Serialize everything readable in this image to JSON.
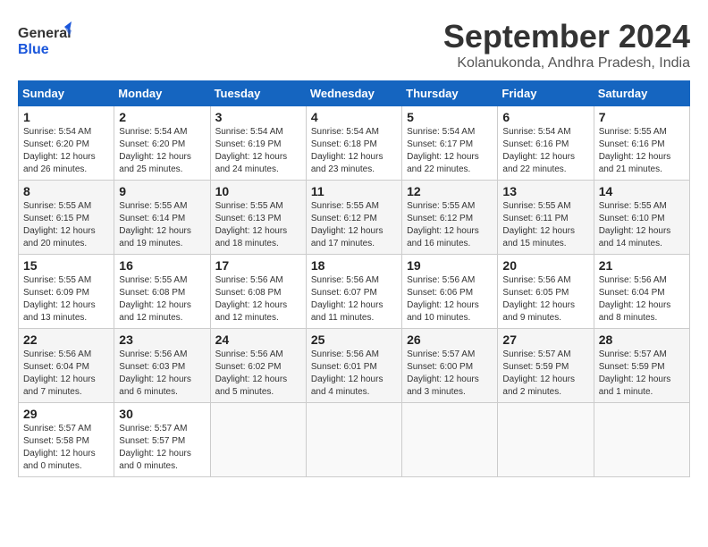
{
  "header": {
    "logo_general": "General",
    "logo_blue": "Blue",
    "month": "September 2024",
    "location": "Kolanukonda, Andhra Pradesh, India"
  },
  "days_of_week": [
    "Sunday",
    "Monday",
    "Tuesday",
    "Wednesday",
    "Thursday",
    "Friday",
    "Saturday"
  ],
  "weeks": [
    [
      {
        "day": "1",
        "sunrise": "5:54 AM",
        "sunset": "6:20 PM",
        "daylight": "12 hours and 26 minutes."
      },
      {
        "day": "2",
        "sunrise": "5:54 AM",
        "sunset": "6:20 PM",
        "daylight": "12 hours and 25 minutes."
      },
      {
        "day": "3",
        "sunrise": "5:54 AM",
        "sunset": "6:19 PM",
        "daylight": "12 hours and 24 minutes."
      },
      {
        "day": "4",
        "sunrise": "5:54 AM",
        "sunset": "6:18 PM",
        "daylight": "12 hours and 23 minutes."
      },
      {
        "day": "5",
        "sunrise": "5:54 AM",
        "sunset": "6:17 PM",
        "daylight": "12 hours and 22 minutes."
      },
      {
        "day": "6",
        "sunrise": "5:54 AM",
        "sunset": "6:16 PM",
        "daylight": "12 hours and 22 minutes."
      },
      {
        "day": "7",
        "sunrise": "5:55 AM",
        "sunset": "6:16 PM",
        "daylight": "12 hours and 21 minutes."
      }
    ],
    [
      {
        "day": "8",
        "sunrise": "5:55 AM",
        "sunset": "6:15 PM",
        "daylight": "12 hours and 20 minutes."
      },
      {
        "day": "9",
        "sunrise": "5:55 AM",
        "sunset": "6:14 PM",
        "daylight": "12 hours and 19 minutes."
      },
      {
        "day": "10",
        "sunrise": "5:55 AM",
        "sunset": "6:13 PM",
        "daylight": "12 hours and 18 minutes."
      },
      {
        "day": "11",
        "sunrise": "5:55 AM",
        "sunset": "6:12 PM",
        "daylight": "12 hours and 17 minutes."
      },
      {
        "day": "12",
        "sunrise": "5:55 AM",
        "sunset": "6:12 PM",
        "daylight": "12 hours and 16 minutes."
      },
      {
        "day": "13",
        "sunrise": "5:55 AM",
        "sunset": "6:11 PM",
        "daylight": "12 hours and 15 minutes."
      },
      {
        "day": "14",
        "sunrise": "5:55 AM",
        "sunset": "6:10 PM",
        "daylight": "12 hours and 14 minutes."
      }
    ],
    [
      {
        "day": "15",
        "sunrise": "5:55 AM",
        "sunset": "6:09 PM",
        "daylight": "12 hours and 13 minutes."
      },
      {
        "day": "16",
        "sunrise": "5:55 AM",
        "sunset": "6:08 PM",
        "daylight": "12 hours and 12 minutes."
      },
      {
        "day": "17",
        "sunrise": "5:56 AM",
        "sunset": "6:08 PM",
        "daylight": "12 hours and 12 minutes."
      },
      {
        "day": "18",
        "sunrise": "5:56 AM",
        "sunset": "6:07 PM",
        "daylight": "12 hours and 11 minutes."
      },
      {
        "day": "19",
        "sunrise": "5:56 AM",
        "sunset": "6:06 PM",
        "daylight": "12 hours and 10 minutes."
      },
      {
        "day": "20",
        "sunrise": "5:56 AM",
        "sunset": "6:05 PM",
        "daylight": "12 hours and 9 minutes."
      },
      {
        "day": "21",
        "sunrise": "5:56 AM",
        "sunset": "6:04 PM",
        "daylight": "12 hours and 8 minutes."
      }
    ],
    [
      {
        "day": "22",
        "sunrise": "5:56 AM",
        "sunset": "6:04 PM",
        "daylight": "12 hours and 7 minutes."
      },
      {
        "day": "23",
        "sunrise": "5:56 AM",
        "sunset": "6:03 PM",
        "daylight": "12 hours and 6 minutes."
      },
      {
        "day": "24",
        "sunrise": "5:56 AM",
        "sunset": "6:02 PM",
        "daylight": "12 hours and 5 minutes."
      },
      {
        "day": "25",
        "sunrise": "5:56 AM",
        "sunset": "6:01 PM",
        "daylight": "12 hours and 4 minutes."
      },
      {
        "day": "26",
        "sunrise": "5:57 AM",
        "sunset": "6:00 PM",
        "daylight": "12 hours and 3 minutes."
      },
      {
        "day": "27",
        "sunrise": "5:57 AM",
        "sunset": "5:59 PM",
        "daylight": "12 hours and 2 minutes."
      },
      {
        "day": "28",
        "sunrise": "5:57 AM",
        "sunset": "5:59 PM",
        "daylight": "12 hours and 1 minute."
      }
    ],
    [
      {
        "day": "29",
        "sunrise": "5:57 AM",
        "sunset": "5:58 PM",
        "daylight": "12 hours and 0 minutes."
      },
      {
        "day": "30",
        "sunrise": "5:57 AM",
        "sunset": "5:57 PM",
        "daylight": "12 hours and 0 minutes."
      },
      null,
      null,
      null,
      null,
      null
    ]
  ]
}
